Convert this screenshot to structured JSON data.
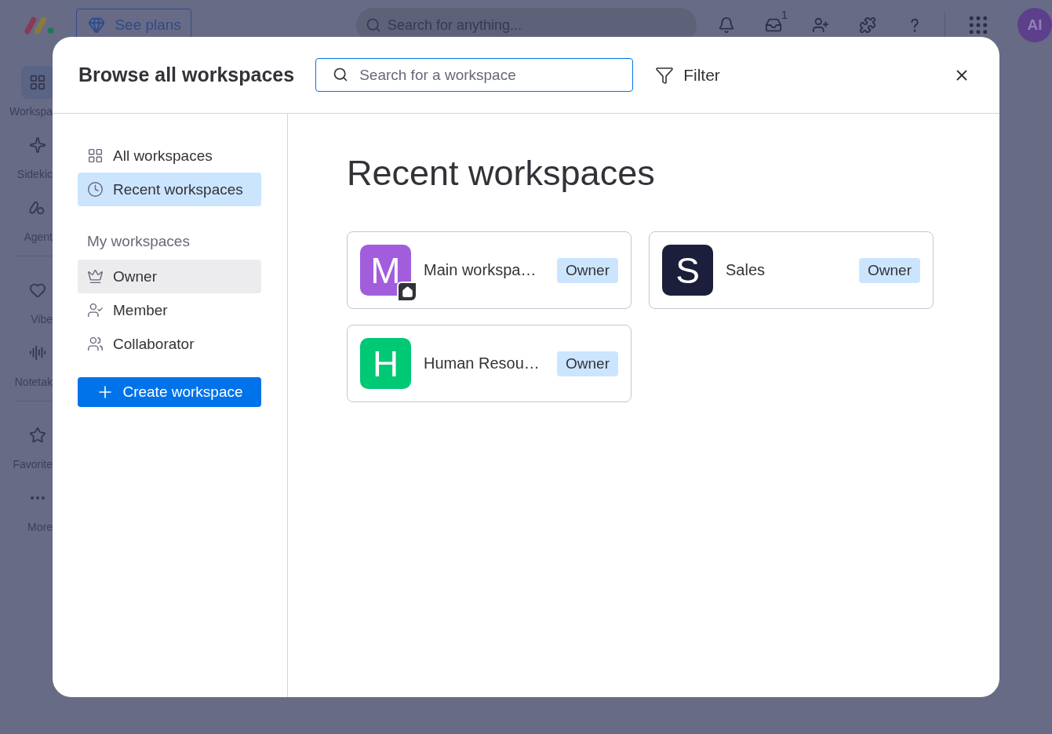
{
  "app_bar": {
    "plans_button": "See plans",
    "search": {
      "placeholder": "Search for anything..."
    },
    "inbox_count": "1",
    "avatar": "AI"
  },
  "rail": {
    "groups": [
      {
        "items": [
          {
            "label": "Workspa",
            "kind": "workspaces",
            "selected": true
          },
          {
            "label": "Sidekic",
            "kind": "sidekick",
            "selected": false
          },
          {
            "label": "Agent",
            "kind": "agents",
            "selected": false
          }
        ]
      },
      {
        "items": [
          {
            "label": "Vibe",
            "kind": "vibe",
            "selected": false
          },
          {
            "label": "Notetak",
            "kind": "notetaker",
            "selected": false
          }
        ]
      },
      {
        "items": [
          {
            "label": "Favorite",
            "kind": "favorites",
            "selected": false
          },
          {
            "label": "More",
            "kind": "more",
            "selected": false
          }
        ]
      }
    ]
  },
  "modal": {
    "title": "Browse all workspaces",
    "search": {
      "placeholder": "Search for a workspace"
    },
    "filter": "Filter",
    "sidebar": {
      "nav": [
        {
          "label": "All workspaces",
          "kind": "grid",
          "selected": false
        },
        {
          "label": "Recent workspaces",
          "kind": "clock",
          "selected": true
        }
      ],
      "section_title": "My workspaces",
      "roles": [
        {
          "label": "Owner",
          "kind": "crown",
          "selected": true
        },
        {
          "label": "Member",
          "kind": "member",
          "selected": false
        },
        {
          "label": "Collaborator",
          "kind": "group",
          "selected": false
        }
      ],
      "create_button": "Create workspace"
    },
    "main": {
      "heading": "Recent workspaces",
      "workspaces": [
        {
          "letter": "M",
          "name": "Main workspa…",
          "role": "Owner",
          "color": "#a25ddc",
          "home": true
        },
        {
          "letter": "S",
          "name": "Sales",
          "role": "Owner",
          "color": "#1c1f3b",
          "home": false
        },
        {
          "letter": "H",
          "name": "Human Resou…",
          "role": "Owner",
          "color": "#00c875",
          "home": false
        }
      ]
    }
  }
}
